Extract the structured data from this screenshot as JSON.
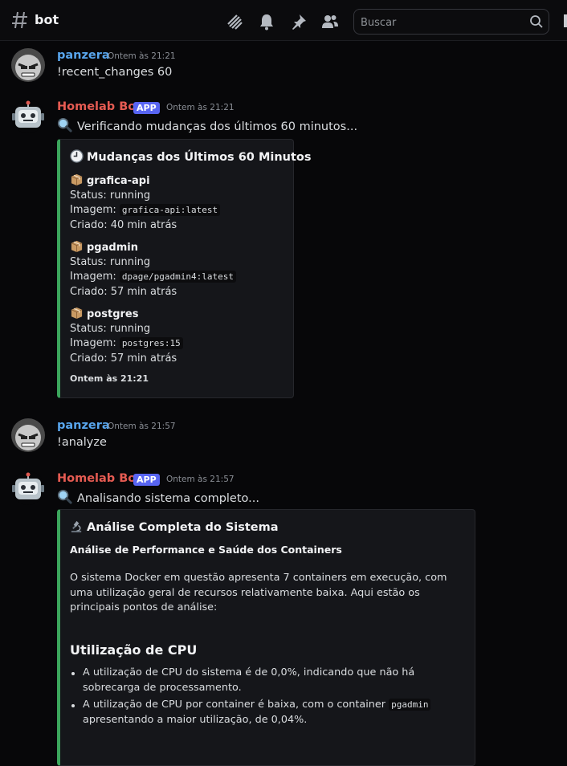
{
  "header": {
    "channel": "bot",
    "search_placeholder": "Buscar",
    "icons": [
      "hash-icon",
      "threads-icon",
      "bell-icon",
      "pin-icon",
      "members-icon",
      "search-icon"
    ]
  },
  "messages": [
    {
      "author": "panzera",
      "timestamp": "Ontem às 21:21",
      "text": "!recent_changes 60"
    },
    {
      "author": "Homelab Bot",
      "badge": "APP",
      "timestamp": "Ontem às 21:21",
      "text": "Verificando mudanças dos últimos 60 minutos...",
      "embed": {
        "title": "Mudanças dos Últimos 60 Minutos",
        "fields": [
          {
            "name": "grafica-api",
            "status": "Status: running",
            "image_label": "Imagem:",
            "image": "grafica-api:latest",
            "created": "Criado: 40 min atrás"
          },
          {
            "name": "pgadmin",
            "status": "Status: running",
            "image_label": "Imagem:",
            "image": "dpage/pgadmin4:latest",
            "created": "Criado: 57 min atrás"
          },
          {
            "name": "postgres",
            "status": "Status: running",
            "image_label": "Imagem:",
            "image": "postgres:15",
            "created": "Criado: 57 min atrás"
          }
        ],
        "footer": "Ontem às 21:21"
      }
    },
    {
      "author": "panzera",
      "timestamp": "Ontem às 21:57",
      "text": "!analyze"
    },
    {
      "author": "Homelab Bot",
      "badge": "APP",
      "timestamp": "Ontem às 21:57",
      "text": "Analisando sistema completo...",
      "embed": {
        "title": "Análise Completa do Sistema",
        "subtitle": "Análise de Performance e Saúde dos Containers",
        "paragraph": "O sistema Docker em questão apresenta 7 containers em execução, com uma utilização geral de recursos relativamente baixa. Aqui estão os principais pontos de análise:",
        "section": "Utilização de CPU",
        "bullet1": "A utilização de CPU do sistema é de 0,0%, indicando que não há sobrecarga de processamento.",
        "bullet2_pre": "A utilização de CPU por container é baixa, com o container ",
        "bullet2_code": "pgadmin",
        "bullet2_post": " apresentando a maior utilização, de 0,04%."
      }
    }
  ],
  "colors": {
    "user": "#58a5ec",
    "bot": "#e55b52",
    "embed_accent": "#3ba55c",
    "badge": "#5865f2"
  }
}
